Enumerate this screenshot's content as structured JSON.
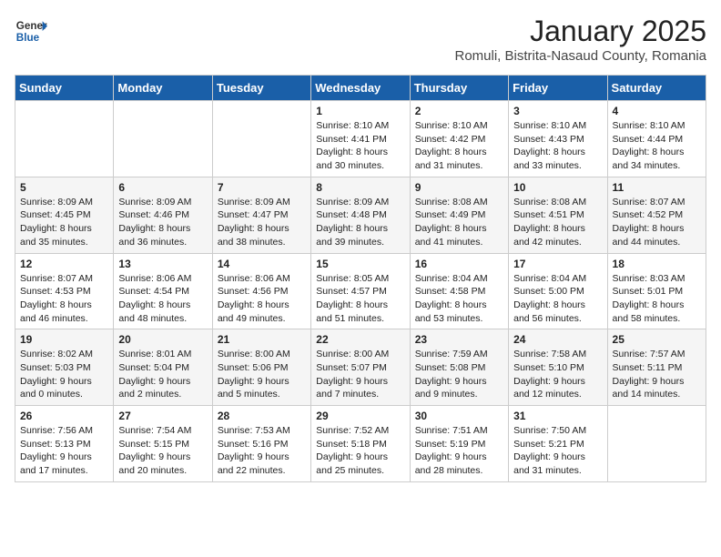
{
  "header": {
    "logo_general": "General",
    "logo_blue": "Blue",
    "month": "January 2025",
    "location": "Romuli, Bistrita-Nasaud County, Romania"
  },
  "weekdays": [
    "Sunday",
    "Monday",
    "Tuesday",
    "Wednesday",
    "Thursday",
    "Friday",
    "Saturday"
  ],
  "weeks": [
    [
      {
        "day": "",
        "info": ""
      },
      {
        "day": "",
        "info": ""
      },
      {
        "day": "",
        "info": ""
      },
      {
        "day": "1",
        "info": "Sunrise: 8:10 AM\nSunset: 4:41 PM\nDaylight: 8 hours\nand 30 minutes."
      },
      {
        "day": "2",
        "info": "Sunrise: 8:10 AM\nSunset: 4:42 PM\nDaylight: 8 hours\nand 31 minutes."
      },
      {
        "day": "3",
        "info": "Sunrise: 8:10 AM\nSunset: 4:43 PM\nDaylight: 8 hours\nand 33 minutes."
      },
      {
        "day": "4",
        "info": "Sunrise: 8:10 AM\nSunset: 4:44 PM\nDaylight: 8 hours\nand 34 minutes."
      }
    ],
    [
      {
        "day": "5",
        "info": "Sunrise: 8:09 AM\nSunset: 4:45 PM\nDaylight: 8 hours\nand 35 minutes."
      },
      {
        "day": "6",
        "info": "Sunrise: 8:09 AM\nSunset: 4:46 PM\nDaylight: 8 hours\nand 36 minutes."
      },
      {
        "day": "7",
        "info": "Sunrise: 8:09 AM\nSunset: 4:47 PM\nDaylight: 8 hours\nand 38 minutes."
      },
      {
        "day": "8",
        "info": "Sunrise: 8:09 AM\nSunset: 4:48 PM\nDaylight: 8 hours\nand 39 minutes."
      },
      {
        "day": "9",
        "info": "Sunrise: 8:08 AM\nSunset: 4:49 PM\nDaylight: 8 hours\nand 41 minutes."
      },
      {
        "day": "10",
        "info": "Sunrise: 8:08 AM\nSunset: 4:51 PM\nDaylight: 8 hours\nand 42 minutes."
      },
      {
        "day": "11",
        "info": "Sunrise: 8:07 AM\nSunset: 4:52 PM\nDaylight: 8 hours\nand 44 minutes."
      }
    ],
    [
      {
        "day": "12",
        "info": "Sunrise: 8:07 AM\nSunset: 4:53 PM\nDaylight: 8 hours\nand 46 minutes."
      },
      {
        "day": "13",
        "info": "Sunrise: 8:06 AM\nSunset: 4:54 PM\nDaylight: 8 hours\nand 48 minutes."
      },
      {
        "day": "14",
        "info": "Sunrise: 8:06 AM\nSunset: 4:56 PM\nDaylight: 8 hours\nand 49 minutes."
      },
      {
        "day": "15",
        "info": "Sunrise: 8:05 AM\nSunset: 4:57 PM\nDaylight: 8 hours\nand 51 minutes."
      },
      {
        "day": "16",
        "info": "Sunrise: 8:04 AM\nSunset: 4:58 PM\nDaylight: 8 hours\nand 53 minutes."
      },
      {
        "day": "17",
        "info": "Sunrise: 8:04 AM\nSunset: 5:00 PM\nDaylight: 8 hours\nand 56 minutes."
      },
      {
        "day": "18",
        "info": "Sunrise: 8:03 AM\nSunset: 5:01 PM\nDaylight: 8 hours\nand 58 minutes."
      }
    ],
    [
      {
        "day": "19",
        "info": "Sunrise: 8:02 AM\nSunset: 5:03 PM\nDaylight: 9 hours\nand 0 minutes."
      },
      {
        "day": "20",
        "info": "Sunrise: 8:01 AM\nSunset: 5:04 PM\nDaylight: 9 hours\nand 2 minutes."
      },
      {
        "day": "21",
        "info": "Sunrise: 8:00 AM\nSunset: 5:06 PM\nDaylight: 9 hours\nand 5 minutes."
      },
      {
        "day": "22",
        "info": "Sunrise: 8:00 AM\nSunset: 5:07 PM\nDaylight: 9 hours\nand 7 minutes."
      },
      {
        "day": "23",
        "info": "Sunrise: 7:59 AM\nSunset: 5:08 PM\nDaylight: 9 hours\nand 9 minutes."
      },
      {
        "day": "24",
        "info": "Sunrise: 7:58 AM\nSunset: 5:10 PM\nDaylight: 9 hours\nand 12 minutes."
      },
      {
        "day": "25",
        "info": "Sunrise: 7:57 AM\nSunset: 5:11 PM\nDaylight: 9 hours\nand 14 minutes."
      }
    ],
    [
      {
        "day": "26",
        "info": "Sunrise: 7:56 AM\nSunset: 5:13 PM\nDaylight: 9 hours\nand 17 minutes."
      },
      {
        "day": "27",
        "info": "Sunrise: 7:54 AM\nSunset: 5:15 PM\nDaylight: 9 hours\nand 20 minutes."
      },
      {
        "day": "28",
        "info": "Sunrise: 7:53 AM\nSunset: 5:16 PM\nDaylight: 9 hours\nand 22 minutes."
      },
      {
        "day": "29",
        "info": "Sunrise: 7:52 AM\nSunset: 5:18 PM\nDaylight: 9 hours\nand 25 minutes."
      },
      {
        "day": "30",
        "info": "Sunrise: 7:51 AM\nSunset: 5:19 PM\nDaylight: 9 hours\nand 28 minutes."
      },
      {
        "day": "31",
        "info": "Sunrise: 7:50 AM\nSunset: 5:21 PM\nDaylight: 9 hours\nand 31 minutes."
      },
      {
        "day": "",
        "info": ""
      }
    ]
  ]
}
